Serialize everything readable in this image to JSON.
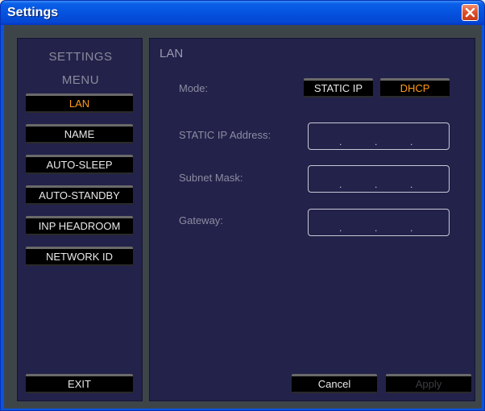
{
  "window": {
    "title": "Settings",
    "close_icon": "close-icon"
  },
  "colors": {
    "titlebar": "#0553e0",
    "panel": "#23224a",
    "active_text": "#ff9a1a",
    "close_button": "#e0522a"
  },
  "sidebar": {
    "heading_line1": "SETTINGS",
    "heading_line2": "MENU",
    "items": [
      {
        "label": "LAN",
        "active": true
      },
      {
        "label": "NAME",
        "active": false
      },
      {
        "label": "AUTO-SLEEP",
        "active": false
      },
      {
        "label": "AUTO-STANDBY",
        "active": false
      },
      {
        "label": "INP HEADROOM",
        "active": false
      },
      {
        "label": "NETWORK ID",
        "active": false
      }
    ],
    "exit_label": "EXIT"
  },
  "main": {
    "section_title": "LAN",
    "mode_label": "Mode:",
    "mode_options": [
      {
        "label": "STATIC IP",
        "selected": false
      },
      {
        "label": "DHCP",
        "selected": true
      }
    ],
    "fields": [
      {
        "label": "STATIC IP Address:",
        "dots": [
          ".",
          ".",
          "."
        ]
      },
      {
        "label": "Subnet Mask:",
        "dots": [
          ".",
          ".",
          "."
        ]
      },
      {
        "label": "Gateway:",
        "dots": [
          ".",
          ".",
          "."
        ]
      }
    ],
    "cancel_label": "Cancel",
    "apply_label": "Apply"
  }
}
